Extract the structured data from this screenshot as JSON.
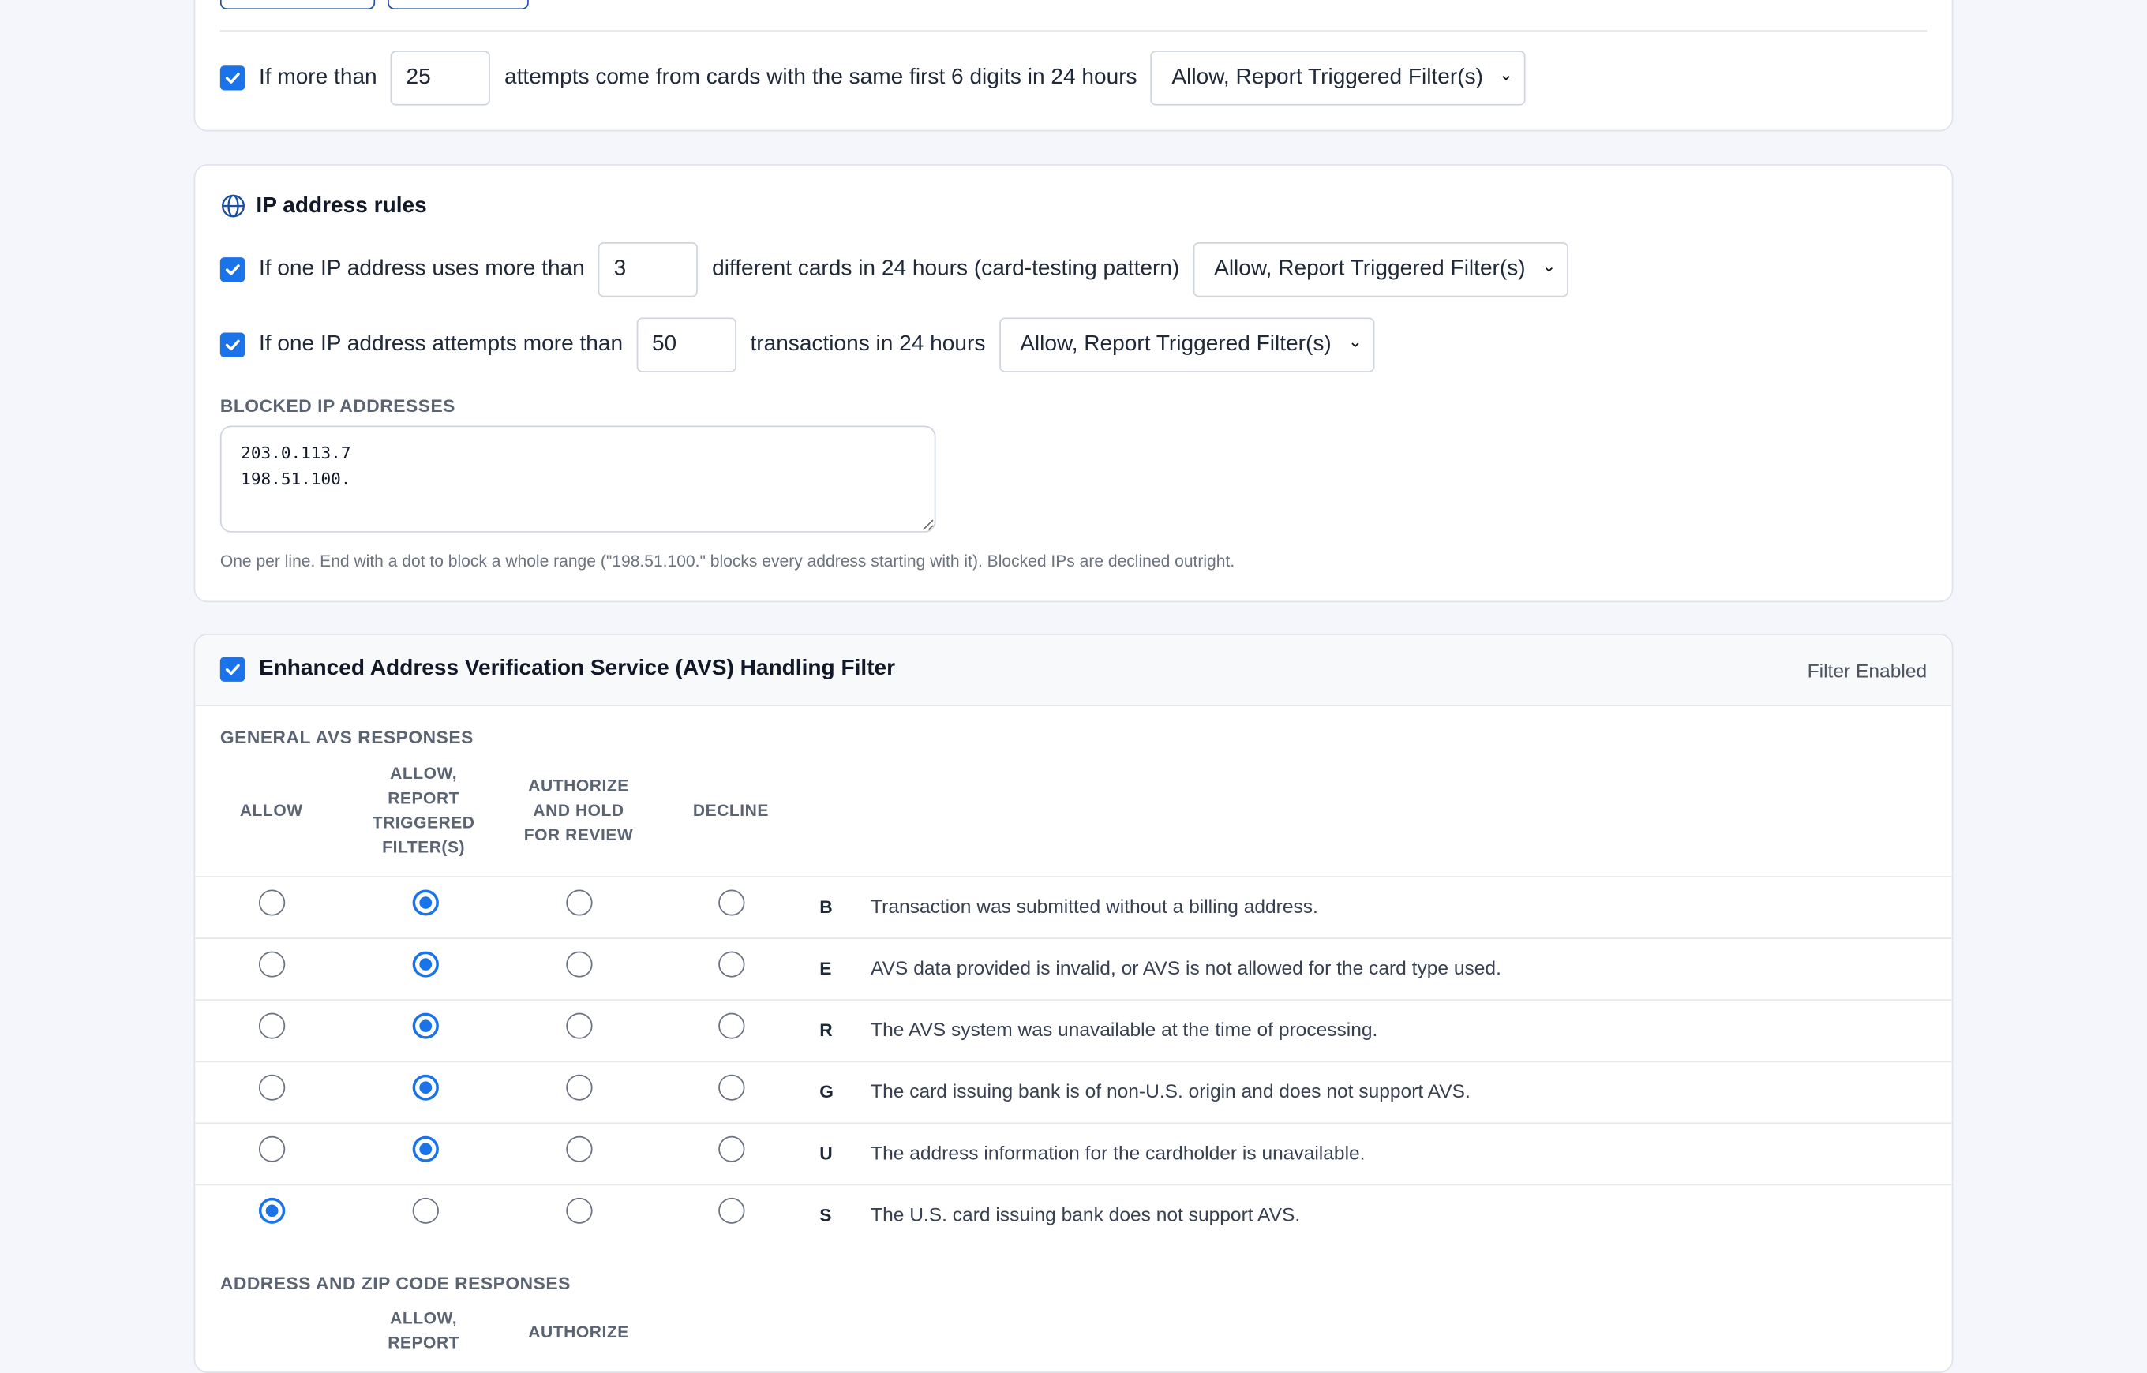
{
  "card_rule": {
    "prefix": "If more than",
    "value": "25",
    "suffix": "attempts come from cards with the same first 6 digits in 24 hours",
    "action": "Allow, Report Triggered Filter(s)"
  },
  "ip_rules": {
    "title": "IP address rules",
    "rule1": {
      "prefix": "If one IP address uses more than",
      "value": "3",
      "suffix": "different cards in 24 hours (card-testing pattern)",
      "action": "Allow, Report Triggered Filter(s)"
    },
    "rule2": {
      "prefix": "If one IP address attempts more than",
      "value": "50",
      "suffix": "transactions in 24 hours",
      "action": "Allow, Report Triggered Filter(s)"
    },
    "blocked_label": "BLOCKED IP ADDRESSES",
    "blocked_value": "203.0.113.7\n198.51.100.",
    "hint": "One per line. End with a dot to block a whole range (\"198.51.100.\" blocks every address starting with it). Blocked IPs are declined outright."
  },
  "avs": {
    "title": "Enhanced Address Verification Service (AVS) Handling Filter",
    "status": "Filter Enabled",
    "general_label": "GENERAL AVS RESPONSES",
    "columns": [
      "ALLOW",
      "ALLOW, REPORT TRIGGERED FILTER(S)",
      "AUTHORIZE AND HOLD FOR REVIEW",
      "DECLINE"
    ],
    "rows": [
      {
        "code": "B",
        "desc": "Transaction was submitted without a billing address.",
        "selected": 1
      },
      {
        "code": "E",
        "desc": "AVS data provided is invalid, or AVS is not allowed for the card type used.",
        "selected": 1
      },
      {
        "code": "R",
        "desc": "The AVS system was unavailable at the time of processing.",
        "selected": 1
      },
      {
        "code": "G",
        "desc": "The card issuing bank is of non-U.S. origin and does not support AVS.",
        "selected": 1
      },
      {
        "code": "U",
        "desc": "The address information for the cardholder is unavailable.",
        "selected": 1
      },
      {
        "code": "S",
        "desc": "The U.S. card issuing bank does not support AVS.",
        "selected": 0
      }
    ],
    "zip_label": "ADDRESS AND ZIP CODE RESPONSES",
    "zip_columns_partial": [
      "ALLOW, REPORT",
      "AUTHORIZE"
    ]
  },
  "colors": {
    "accent": "#1a73e8",
    "page_bg": "#f4f6fb"
  }
}
